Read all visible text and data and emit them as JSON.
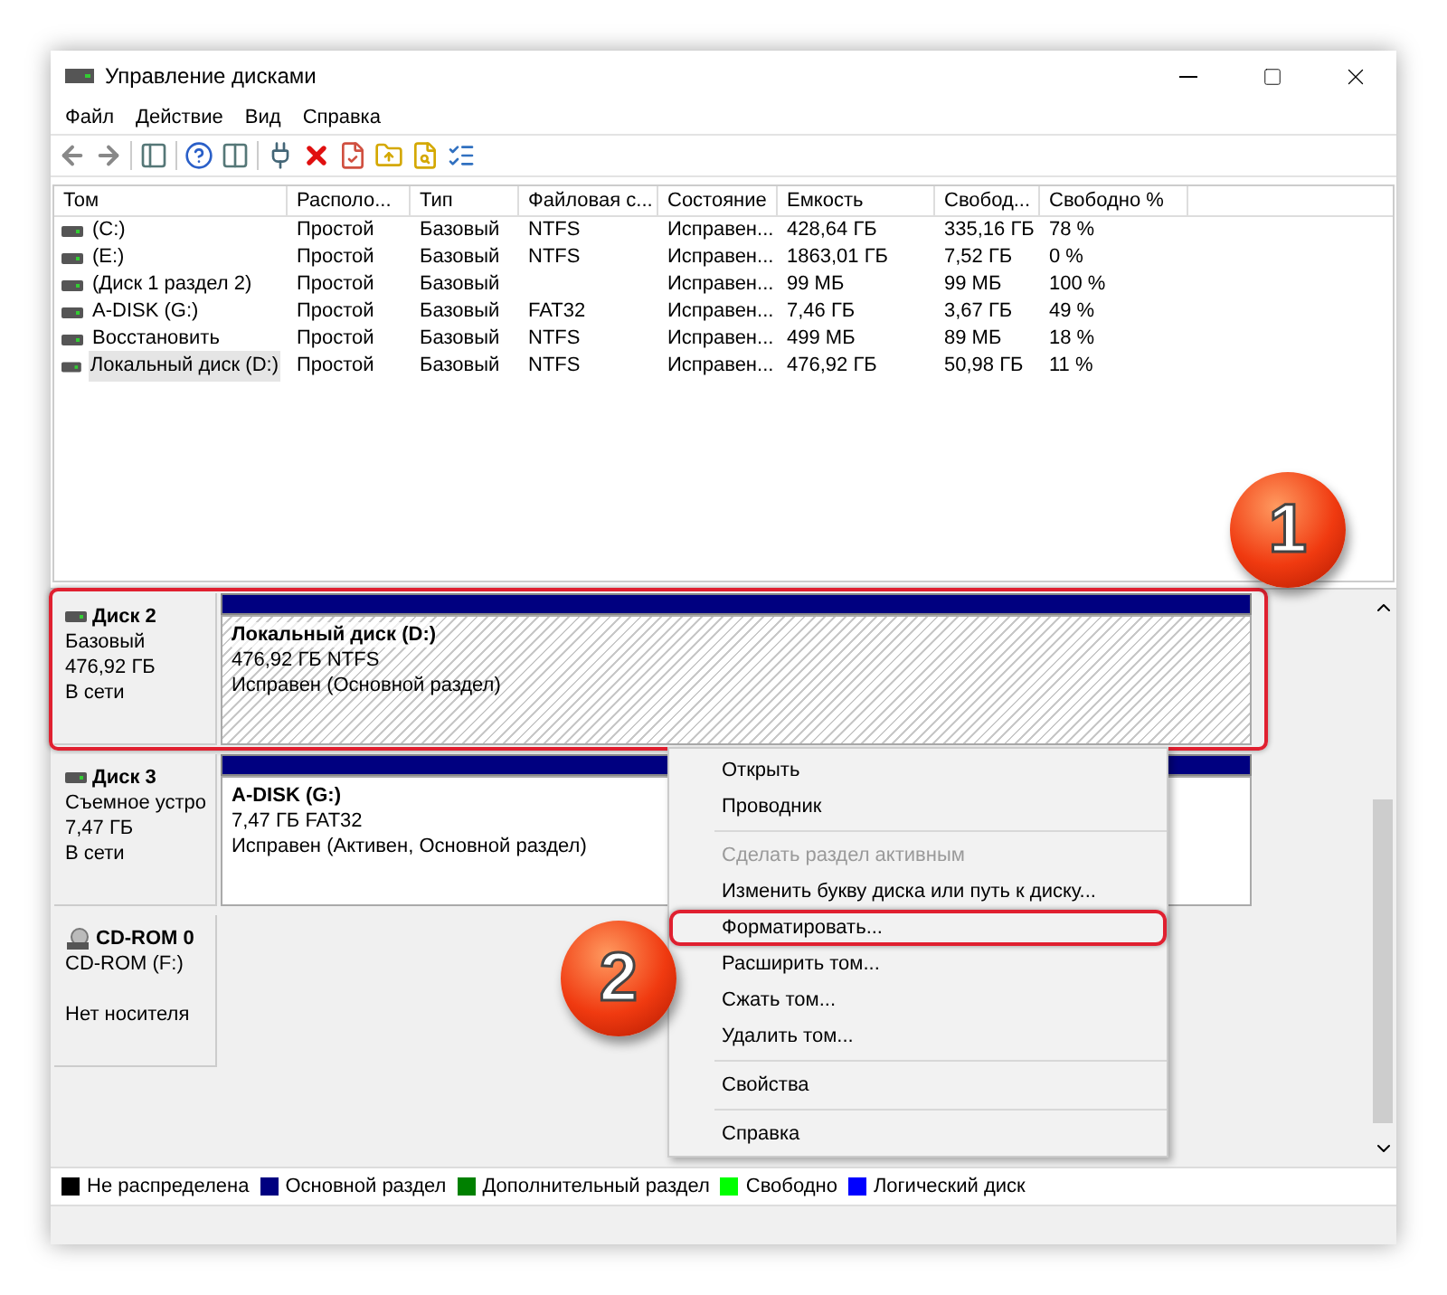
{
  "window": {
    "title": "Управление дисками"
  },
  "menu": [
    "Файл",
    "Действие",
    "Вид",
    "Справка"
  ],
  "table": {
    "columns": [
      "Том",
      "Располо...",
      "Тип",
      "Файловая с...",
      "Состояние",
      "Емкость",
      "Свобод...",
      "Свободно %"
    ],
    "rows": [
      {
        "selected": false,
        "cells": [
          "(C:)",
          "Простой",
          "Базовый",
          "NTFS",
          "Исправен...",
          "428,64 ГБ",
          "335,16 ГБ",
          "78 %"
        ]
      },
      {
        "selected": false,
        "cells": [
          "(E:)",
          "Простой",
          "Базовый",
          "NTFS",
          "Исправен...",
          "1863,01 ГБ",
          "7,52 ГБ",
          "0 %"
        ]
      },
      {
        "selected": false,
        "cells": [
          "(Диск 1 раздел 2)",
          "Простой",
          "Базовый",
          "",
          "Исправен...",
          "99 МБ",
          "99 МБ",
          "100 %"
        ]
      },
      {
        "selected": false,
        "cells": [
          "A-DISK (G:)",
          "Простой",
          "Базовый",
          "FAT32",
          "Исправен...",
          "7,46 ГБ",
          "3,67 ГБ",
          "49 %"
        ]
      },
      {
        "selected": false,
        "cells": [
          "Восстановить",
          "Простой",
          "Базовый",
          "NTFS",
          "Исправен...",
          "499 МБ",
          "89 МБ",
          "18 %"
        ]
      },
      {
        "selected": true,
        "cells": [
          "Локальный диск (D:)",
          "Простой",
          "Базовый",
          "NTFS",
          "Исправен...",
          "476,92 ГБ",
          "50,98 ГБ",
          "11 %"
        ]
      }
    ]
  },
  "disks": [
    {
      "kind": "disk",
      "name": "Диск 2",
      "lines": [
        "Базовый",
        "476,92 ГБ",
        "В сети"
      ],
      "highlighted": true,
      "partitions": [
        {
          "name": "Локальный диск  (D:)",
          "size": "476,92 ГБ NTFS",
          "status": "Исправен (Основной раздел)",
          "selected": true
        }
      ]
    },
    {
      "kind": "disk",
      "name": "Диск 3",
      "lines": [
        "Съемное устро",
        "7,47 ГБ",
        "В сети"
      ],
      "highlighted": false,
      "partitions": [
        {
          "name": "A-DISK  (G:)",
          "size": "7,47 ГБ FAT32",
          "status": "Исправен (Активен, Основной раздел)",
          "selected": false
        }
      ]
    },
    {
      "kind": "cdrom",
      "name": "CD-ROM 0",
      "lines": [
        "CD-ROM (F:)",
        "Нет носителя"
      ],
      "highlighted": false
    }
  ],
  "context_menu": {
    "groups": [
      [
        {
          "label": "Открыть",
          "disabled": false,
          "highlighted": false
        },
        {
          "label": "Проводник",
          "disabled": false,
          "highlighted": false
        }
      ],
      [
        {
          "label": "Сделать раздел активным",
          "disabled": true,
          "highlighted": false
        },
        {
          "label": "Изменить букву диска или путь к диску...",
          "disabled": false,
          "highlighted": false
        },
        {
          "label": "Форматировать...",
          "disabled": false,
          "highlighted": true
        },
        {
          "label": "Расширить том...",
          "disabled": false,
          "highlighted": false
        },
        {
          "label": "Сжать том...",
          "disabled": false,
          "highlighted": false
        },
        {
          "label": "Удалить том...",
          "disabled": false,
          "highlighted": false
        }
      ],
      [
        {
          "label": "Свойства",
          "disabled": false,
          "highlighted": false
        }
      ],
      [
        {
          "label": "Справка",
          "disabled": false,
          "highlighted": false
        }
      ]
    ]
  },
  "callouts": [
    "1",
    "2"
  ],
  "legend": [
    {
      "label": "Не распределена",
      "color": "#000000"
    },
    {
      "label": "Основной раздел",
      "color": "#000080"
    },
    {
      "label": "Дополнительный раздел",
      "color": "#008000"
    },
    {
      "label": "Свободно",
      "color": "#00ff00"
    },
    {
      "label": "Логический диск",
      "color": "#0000ff"
    }
  ]
}
